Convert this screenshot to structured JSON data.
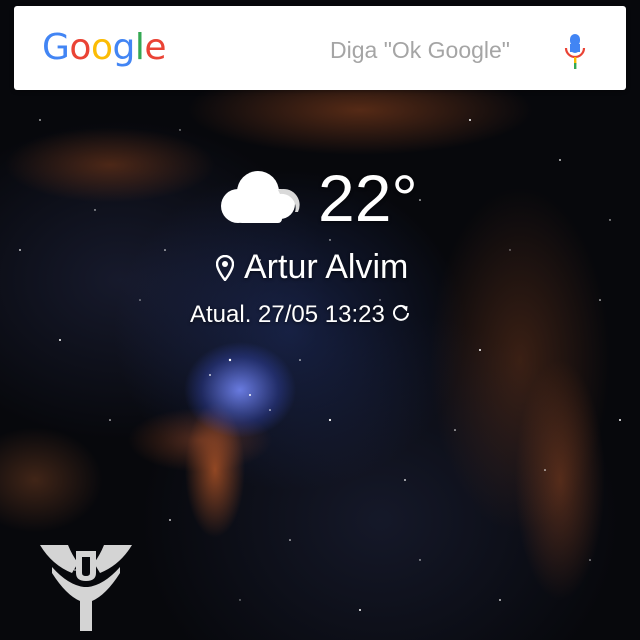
{
  "search": {
    "logo_letters": [
      {
        "char": "G",
        "color": "#4285F4"
      },
      {
        "char": "o",
        "color": "#EA4335"
      },
      {
        "char": "o",
        "color": "#FBBC05"
      },
      {
        "char": "g",
        "color": "#4285F4"
      },
      {
        "char": "l",
        "color": "#34A853"
      },
      {
        "char": "e",
        "color": "#EA4335"
      }
    ],
    "hint": "Diga \"Ok Google\"",
    "mic_icon": "mic-icon"
  },
  "weather": {
    "condition_icon": "cloud-icon",
    "temperature": "22°",
    "location_icon": "pin-icon",
    "location": "Artur Alvim",
    "updated": "Atual. 27/05 13:23",
    "refresh_icon": "refresh-icon"
  },
  "home": {
    "app_icon": "destiny-logo"
  }
}
